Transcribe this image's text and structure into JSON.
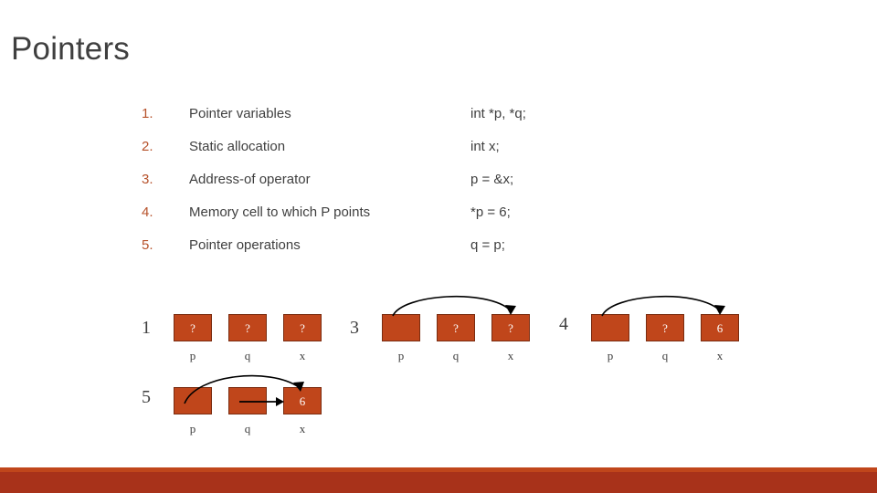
{
  "title": "Pointers",
  "list": [
    {
      "num": "1.",
      "desc": "Pointer variables",
      "code": "int *p, *q;"
    },
    {
      "num": "2.",
      "desc": "Static allocation",
      "code": "int x;"
    },
    {
      "num": "3.",
      "desc": "Address-of operator",
      "code": "p = &x;"
    },
    {
      "num": "4.",
      "desc": "Memory cell to which P points",
      "code": "*p = 6;"
    },
    {
      "num": "5.",
      "desc": "Pointer operations",
      "code": "q = p;"
    }
  ],
  "diagram": {
    "groups": [
      {
        "label": "1",
        "cells": [
          {
            "value": "?",
            "name": "p"
          },
          {
            "value": "?",
            "name": "q"
          },
          {
            "value": "?",
            "name": "x"
          }
        ]
      },
      {
        "label": "3",
        "cells": [
          {
            "value": "",
            "name": "p"
          },
          {
            "value": "?",
            "name": "q"
          },
          {
            "value": "?",
            "name": "x"
          }
        ]
      },
      {
        "label": "4",
        "cells": [
          {
            "value": "",
            "name": "p"
          },
          {
            "value": "?",
            "name": "q"
          },
          {
            "value": "6",
            "name": "x"
          }
        ]
      },
      {
        "label": "5",
        "cells": [
          {
            "value": "",
            "name": "p"
          },
          {
            "value": "",
            "name": "q"
          },
          {
            "value": "6",
            "name": "x"
          }
        ]
      }
    ]
  },
  "colors": {
    "accent": "#c0461b",
    "bar": "#a8321a",
    "number": "#b6512a",
    "text": "#3f3f3f"
  }
}
